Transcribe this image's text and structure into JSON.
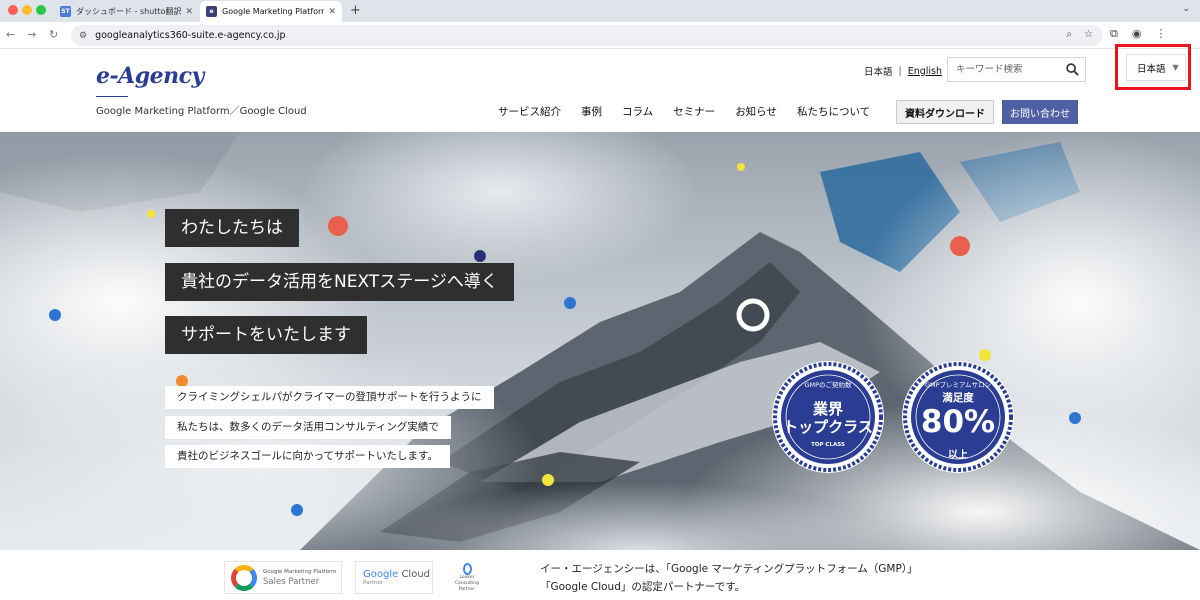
{
  "browser": {
    "tabs": [
      {
        "favicon": "ST",
        "title": "ダッシュボード - shutto翻訳",
        "active": false
      },
      {
        "favicon": "e",
        "title": "Google Marketing Platform , C",
        "active": true
      }
    ],
    "new_tab_symbol": "+",
    "url": "googleanalytics360-suite.e-agency.co.jp"
  },
  "header": {
    "logo_text": "e-Agency",
    "tagline": "Google Marketing Platform／Google Cloud",
    "lang_ja": "日本語",
    "lang_en": "English",
    "search_placeholder": "キーワード検索",
    "lang_select_value": "日本語",
    "nav": [
      "サービス紹介",
      "事例",
      "コラム",
      "セミナー",
      "お知らせ",
      "私たちについて"
    ],
    "download_button": "資料ダウンロード",
    "contact_button": "お問い合わせ"
  },
  "hero": {
    "headlines": [
      "わたしたちは",
      "貴社のデータ活用をNEXTステージへ導く",
      "サポートをいたします"
    ],
    "sublines": [
      "クライミングシェルパがクライマーの登頂サポートを行うように",
      "私たちは、数多くのデータ活用コンサルティング実績で",
      "貴社のビジネスゴールに向かってサポートいたします。"
    ],
    "badge_1": {
      "arc": "GMPのご契約数",
      "main_1": "業界",
      "main_2": "トップクラス",
      "sub": "TOP CLASS"
    },
    "badge_2": {
      "arc": "GMPプレミアムサロン",
      "top": "満足度",
      "value": "80%",
      "unit": "以上"
    }
  },
  "partners": {
    "gmp_line_1": "Google Marketing Platform",
    "gmp_line_2": "Sales Partner",
    "gc_name_google": "Google",
    "gc_name_cloud": " Cloud",
    "gc_sub": "Partner",
    "looker_text": "Looker Consulting Partner",
    "text_line_1": "イー・エージェンシーは、「Google マーケティングプラットフォーム（GMP）」",
    "text_line_2": "「Google Cloud」の認定パートナーです。"
  },
  "colors": {
    "brand_blue": "#2a3d93",
    "contact_button": "#4e5fa4",
    "highlight_outline": "#e8151b",
    "headline_bg": "#2f2f2f"
  }
}
